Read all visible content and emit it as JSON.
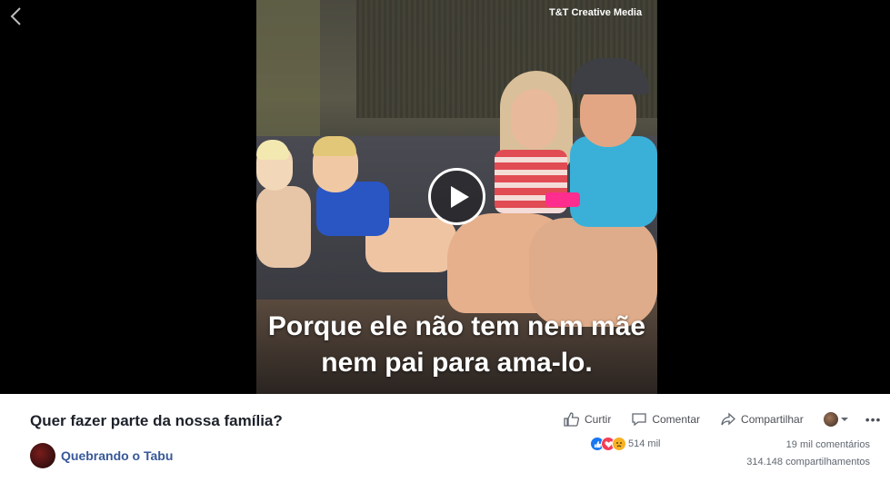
{
  "viewer": {
    "watermark": "T&T Creative Media",
    "subtitle_line1": "Porque ele não tem nem mãe",
    "subtitle_line2": "nem pai para ama-lo."
  },
  "post": {
    "title": "Quer fazer parte da nossa família?",
    "page_name": "Quebrando o Tabu"
  },
  "actions": {
    "like": "Curtir",
    "comment": "Comentar",
    "share": "Compartilhar"
  },
  "reactions": {
    "count": "514 mil",
    "icons": [
      "like-icon",
      "love-icon",
      "sad-icon"
    ]
  },
  "stats": {
    "comments": "19 mil comentários",
    "shares": "314.148 compartilhamentos"
  }
}
